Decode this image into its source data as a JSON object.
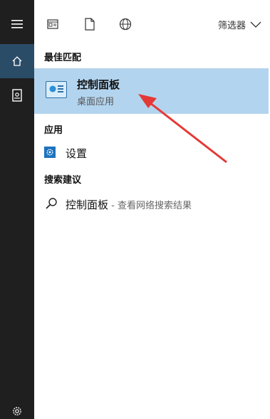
{
  "rail": {
    "items": [
      {
        "icon": "hamburger-menu-icon"
      },
      {
        "icon": "home-icon",
        "active": true
      },
      {
        "icon": "notebook-icon"
      },
      {
        "icon": "gear-icon"
      }
    ]
  },
  "topbar": {
    "filter_label": "筛选器",
    "icons": [
      "document-view-icon",
      "file-icon",
      "globe-icon",
      "chevron-down-icon"
    ]
  },
  "sections": {
    "best_match": "最佳匹配",
    "apps": "应用",
    "suggestions": "搜索建议"
  },
  "best_item": {
    "title": "控制面板",
    "subtitle": "桌面应用"
  },
  "app_item": {
    "label": "设置"
  },
  "suggestion": {
    "query": "控制面板",
    "hint": " - 查看网络搜索结果"
  },
  "colors": {
    "rail_bg": "#1f1f1f",
    "rail_active": "#2b4c67",
    "highlight": "#b3d4ee",
    "arrow": "#e53935"
  }
}
